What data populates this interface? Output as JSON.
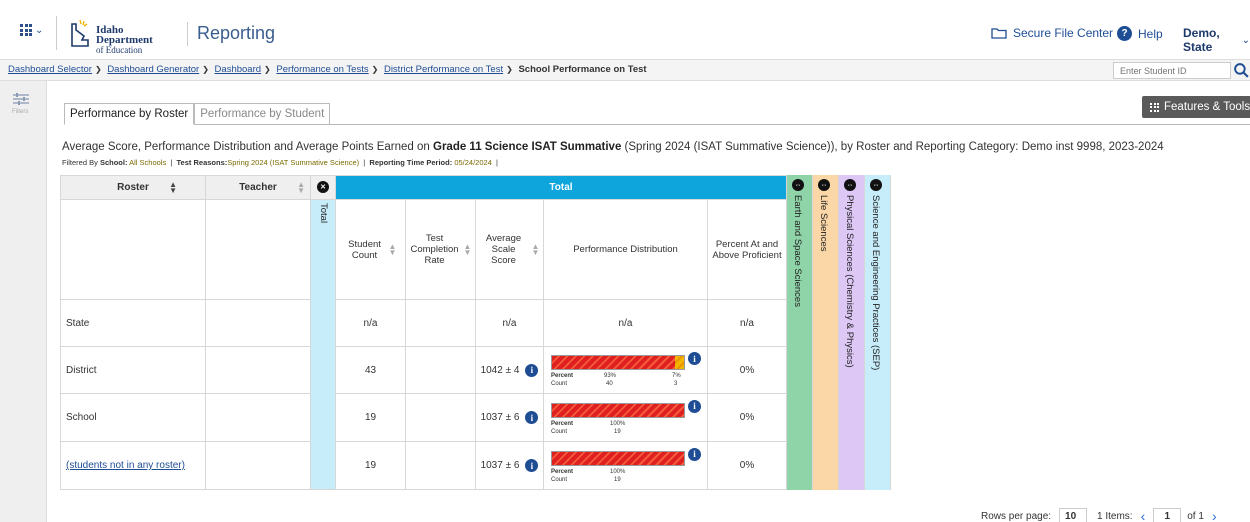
{
  "header": {
    "org_line1": "Idaho Department",
    "org_line2": "of Education",
    "app_title": "Reporting",
    "secure_file_center": "Secure File Center",
    "help": "Help",
    "user": "Demo, State"
  },
  "breadcrumb": {
    "items": [
      "Dashboard Selector",
      "Dashboard Generator",
      "Dashboard",
      "Performance on Tests",
      "District Performance on Test"
    ],
    "current": "School Performance on Test",
    "student_search_placeholder": "Enter Student ID"
  },
  "left_strip": {
    "filter_label": "Filters"
  },
  "tabs": [
    "Performance by Roster",
    "Performance by Student"
  ],
  "features_tools": "Features & Tools",
  "report": {
    "title_prefix": "Average Score, Performance Distribution and Average Points Earned on ",
    "title_bold": "Grade 11 Science ISAT Summative",
    "title_suffix": " (Spring 2024 (ISAT Summative Science)), by Roster and Reporting Category: Demo inst 9998, 2023-2024",
    "filter_prefix": "Filtered By",
    "filter_school_label": "School:",
    "filter_school_value": "All Schools",
    "filter_reasons_label": "Test Reasons:",
    "filter_reasons_value": "Spring 2024 (ISAT Summative Science)",
    "filter_period_label": "Reporting Time Period:",
    "filter_period_value": "05/24/2024"
  },
  "table": {
    "col_roster": "Roster",
    "col_teacher": "Teacher",
    "col_total_vertical": "Total",
    "total_band": "Total",
    "col_student_count": "Student Count",
    "col_test_completion": "Test Completion Rate",
    "col_avg_scale": "Average Scale Score",
    "col_perf_dist": "Performance Distribution",
    "col_pct_proficient": "Percent At and Above Proficient",
    "categories": [
      "Earth and Space Sciences",
      "Life Sciences",
      "Physical Sciences (Chemistry & Physics)",
      "Science and Engineering Practices (SEP)"
    ],
    "category_colors": [
      "#8fd3a8",
      "#fbd7a8",
      "#dcc7f5",
      "#c7ecfa"
    ],
    "pd_percent_label": "Percent",
    "pd_count_label": "Count",
    "rows": [
      {
        "roster": "State",
        "student_count": "n/a",
        "avg_scale": "n/a",
        "perf": "n/a",
        "pct": "n/a"
      },
      {
        "roster": "District",
        "student_count": "43",
        "avg_scale": "1042 ± 4",
        "pct": "0%",
        "pd": {
          "red_pct": "93%",
          "yellow_pct": "7%",
          "red_count": "40",
          "yellow_count": "3",
          "red_fraction": 0.93,
          "yellow_fraction": 0.07
        }
      },
      {
        "roster": "School",
        "student_count": "19",
        "avg_scale": "1037 ± 6",
        "pct": "0%",
        "pd": {
          "red_pct": "100%",
          "red_count": "19",
          "red_fraction": 1.0
        }
      },
      {
        "roster": "(students not in any roster)",
        "student_count": "19",
        "avg_scale": "1037 ± 6",
        "pct": "0%",
        "pd": {
          "red_pct": "100%",
          "red_count": "19",
          "red_fraction": 1.0
        }
      }
    ]
  },
  "footer": {
    "rows_per_page_label": "Rows per page:",
    "rows_per_page": "10",
    "items_label": "1 Items:",
    "page": "1",
    "of_pages": "of 1"
  }
}
